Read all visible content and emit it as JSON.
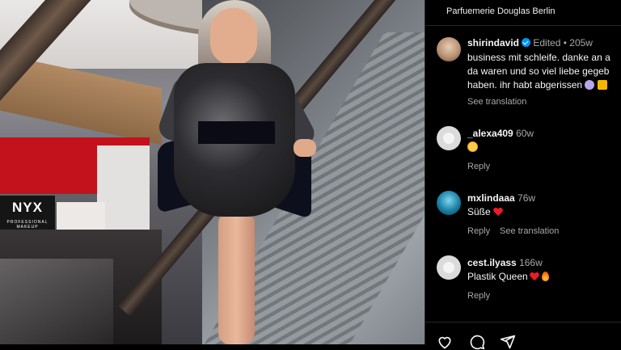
{
  "location": {
    "name": "Parfuemerie Douglas Berlin"
  },
  "post": {
    "author": "shirindavid",
    "edited_label": "Edited",
    "separator": "•",
    "age": "205w",
    "caption_lines": [
      "business mit schleife. danke an a",
      "da waren und so viel liebe gegeb",
      "haben. ihr habt abgerissen"
    ],
    "see_translation": "See translation"
  },
  "comments": [
    {
      "user": "_alexa409",
      "age": "60w",
      "text": "",
      "reply": "Reply",
      "see_translation": ""
    },
    {
      "user": "mxlindaaa",
      "age": "76w",
      "text": "Süße",
      "reply": "Reply",
      "see_translation": "See translation"
    },
    {
      "user": "cest.ilyass",
      "age": "166w",
      "text": "Plastik Queen",
      "reply": "Reply",
      "see_translation": ""
    }
  ],
  "photo": {
    "store_sign": "NYX",
    "store_sign_sub": "PROFESSIONAL MAKEUP"
  },
  "icons": {
    "verified": "verified-badge-icon",
    "heart": "heart-icon",
    "comment": "comment-icon",
    "share": "share-icon"
  },
  "colors": {
    "background": "#000000",
    "accent_blue": "#0095f6",
    "muted_text": "#a8a8a8"
  }
}
